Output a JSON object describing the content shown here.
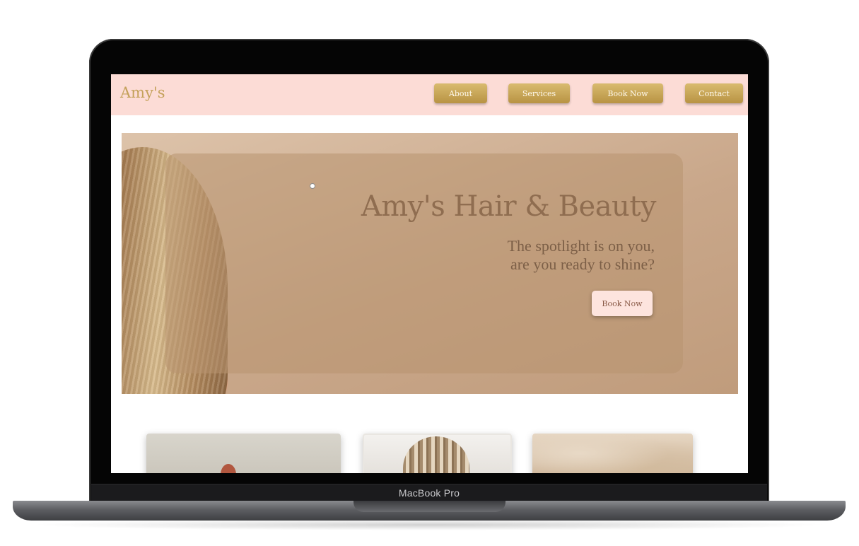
{
  "device": {
    "model_label": "MacBook Pro"
  },
  "website": {
    "brand": "Amy's",
    "nav": [
      {
        "label": "About"
      },
      {
        "label": "Services"
      },
      {
        "label": "Book Now"
      },
      {
        "label": "Contact"
      }
    ],
    "hero": {
      "title": "Amy's Hair & Beauty",
      "subtitle_line1": "The spotlight is on you,",
      "subtitle_line2": "are you ready to shine?",
      "cta_label": "Book Now"
    }
  },
  "colors": {
    "navbar_bg": "#fcdcd6",
    "gold_accent": "#c4a15a",
    "hero_bg": "#c9a78a",
    "cta_bg": "#fde4de"
  }
}
